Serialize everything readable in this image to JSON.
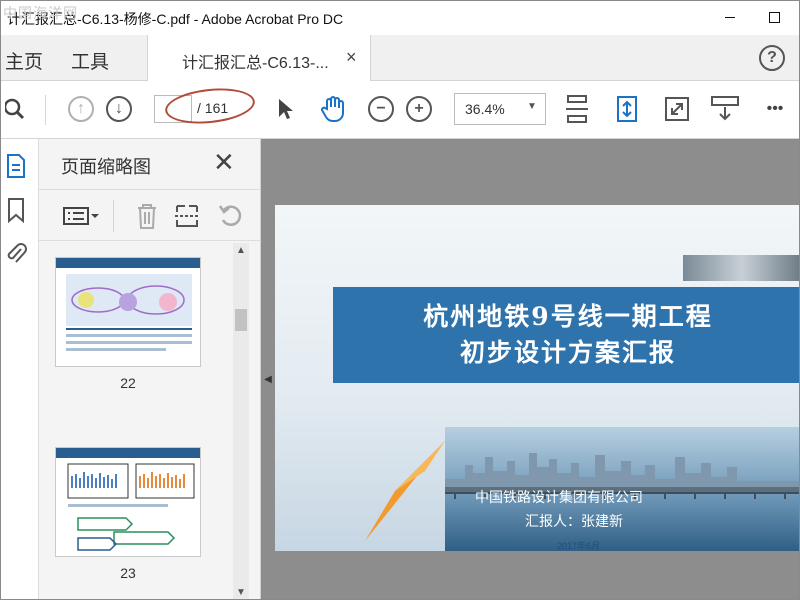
{
  "window": {
    "title": "计汇报汇总-C6.13-杨修-C.pdf - Adobe Acrobat Pro DC",
    "watermark": "中国海洋网"
  },
  "tabs": {
    "home": "主页",
    "tools": "工具",
    "document": "计汇报汇总-C6.13-...",
    "close": "×",
    "help": "?"
  },
  "toolbar": {
    "page_current": "",
    "page_total": "/ 161",
    "zoom": "36.4%",
    "zoom_caret": "▼",
    "more": "•••"
  },
  "panel": {
    "title": "页面缩略图",
    "thumbnails": [
      {
        "page": "22"
      },
      {
        "page": "23"
      }
    ]
  },
  "slide": {
    "title_line1": "杭州地铁9号线一期工程",
    "title_line2": "初步设计方案汇报",
    "organization": "中国铁路设计集团有限公司",
    "reporter": "汇报人：张建新",
    "date": "2017年6月"
  },
  "colors": {
    "accent_blue": "#2f73ad",
    "annotation_red": "#b24b3a"
  }
}
